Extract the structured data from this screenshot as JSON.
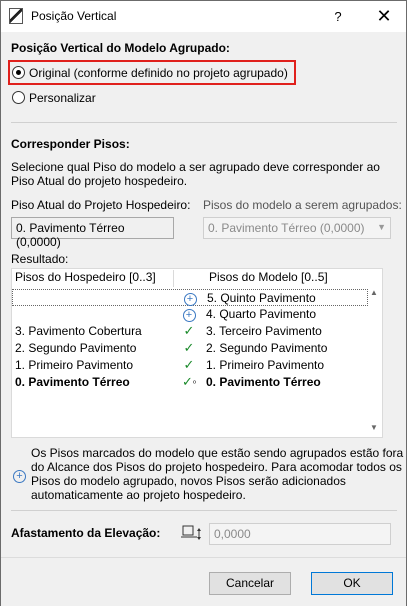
{
  "window": {
    "title": "Posição Vertical",
    "help": "?",
    "close": "✕"
  },
  "vertical_position": {
    "heading": "Posição Vertical do Modelo Agrupado:",
    "option_original": "Original (conforme definido no projeto agrupado)",
    "option_custom": "Personalizar"
  },
  "match_stories": {
    "heading": "Corresponder Pisos:",
    "description_line1": "Selecione qual Piso do modelo a ser agrupado deve corresponder ao",
    "description_line2": "Piso Atual do projeto hospedeiro.",
    "host_label": "Piso Atual do Projeto Hospedeiro:",
    "host_value": "0. Pavimento Térreo (0,0000)",
    "model_label": "Pisos do modelo a serem agrupados:",
    "model_value": "0. Pavimento Térreo (0,0000)"
  },
  "results": {
    "label": "Resultado:",
    "col_host": "Pisos do Hospedeiro [0..3]",
    "col_model": "Pisos do Modelo [0..5]",
    "rows": [
      {
        "host": "",
        "model": "5. Quinto Pavimento"
      },
      {
        "host": "",
        "model": "4. Quarto Pavimento"
      },
      {
        "host": "3. Pavimento Cobertura",
        "model": "3. Terceiro Pavimento"
      },
      {
        "host": "2. Segundo Pavimento",
        "model": "2. Segundo Pavimento"
      },
      {
        "host": "1. Primeiro Pavimento",
        "model": "1. Primeiro Pavimento"
      },
      {
        "host": "0. Pavimento Térreo",
        "model": "0. Pavimento Térreo"
      }
    ],
    "check_mark": "✓",
    "current_mark": "⁰"
  },
  "note": {
    "line1": "Os Pisos marcados do modelo que estão sendo agrupados estão fora",
    "line2": "do Alcance dos Pisos do projeto hospedeiro. Para acomodar todos os",
    "line3": "Pisos do modelo agrupado, novos Pisos serão adicionados",
    "line4": "automaticamente ao projeto hospedeiro."
  },
  "elevation_offset": {
    "label": "Afastamento da Elevação:",
    "value": "0,0000"
  },
  "buttons": {
    "cancel": "Cancelar",
    "ok": "OK"
  },
  "colors": {
    "accent": "#0078d7",
    "highlight": "#e0201c",
    "check": "#1a8a2a",
    "plus": "#3a78c2"
  }
}
